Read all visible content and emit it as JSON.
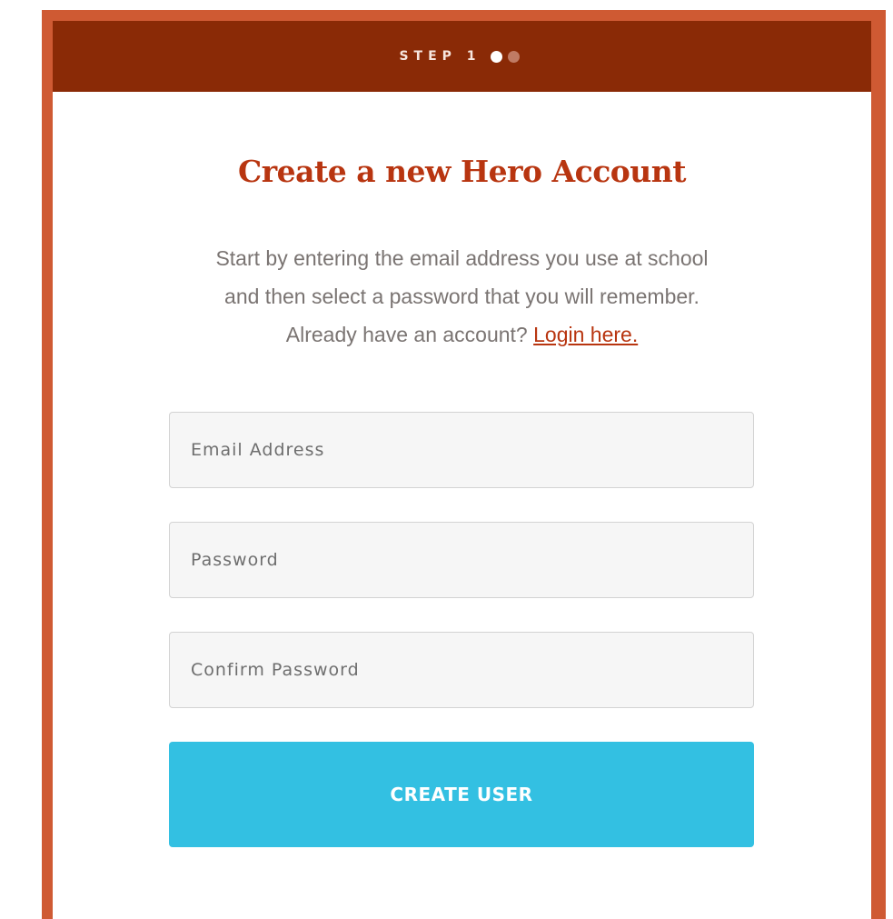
{
  "header": {
    "step_label": "STEP 1",
    "steps_total": 2,
    "current_step": 1
  },
  "title": "Create a new Hero Account",
  "intro": {
    "line1": "Start by entering the email address you use at school",
    "line2": "and then select a password that you will remember.",
    "line3_prefix": "Already have an account?",
    "login_link": "Login here."
  },
  "form": {
    "email_placeholder": "Email Address",
    "password_placeholder": "Password",
    "confirm_placeholder": "Confirm Password",
    "submit_label": "CREATE USER"
  },
  "colors": {
    "frame": "#cf5a33",
    "header": "#8a2a06",
    "title": "#b83510",
    "button": "#33c0e2"
  }
}
